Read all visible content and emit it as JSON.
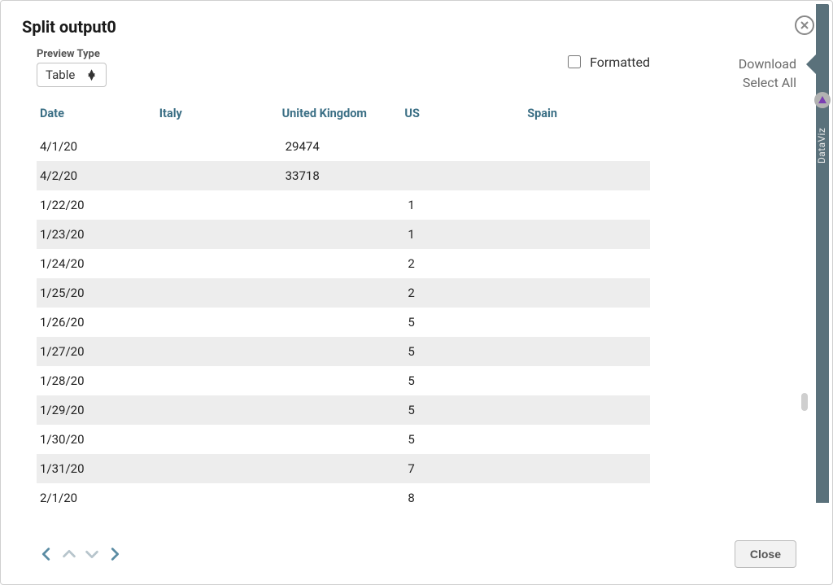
{
  "title": "Split output0",
  "previewType": {
    "label": "Preview Type",
    "value": "Table"
  },
  "formatted": {
    "label": "Formatted",
    "checked": false
  },
  "links": {
    "download": "Download",
    "selectAll": "Select All"
  },
  "sidePanel": {
    "label": "DataViz"
  },
  "columns": [
    "Date",
    "Italy",
    "United Kingdom",
    "US",
    "Spain"
  ],
  "rows": [
    {
      "date": "4/1/20",
      "italy": "",
      "uk": "29474",
      "us": "",
      "spain": ""
    },
    {
      "date": "4/2/20",
      "italy": "",
      "uk": "33718",
      "us": "",
      "spain": ""
    },
    {
      "date": "1/22/20",
      "italy": "",
      "uk": "",
      "us": "1",
      "spain": ""
    },
    {
      "date": "1/23/20",
      "italy": "",
      "uk": "",
      "us": "1",
      "spain": ""
    },
    {
      "date": "1/24/20",
      "italy": "",
      "uk": "",
      "us": "2",
      "spain": ""
    },
    {
      "date": "1/25/20",
      "italy": "",
      "uk": "",
      "us": "2",
      "spain": ""
    },
    {
      "date": "1/26/20",
      "italy": "",
      "uk": "",
      "us": "5",
      "spain": ""
    },
    {
      "date": "1/27/20",
      "italy": "",
      "uk": "",
      "us": "5",
      "spain": ""
    },
    {
      "date": "1/28/20",
      "italy": "",
      "uk": "",
      "us": "5",
      "spain": ""
    },
    {
      "date": "1/29/20",
      "italy": "",
      "uk": "",
      "us": "5",
      "spain": ""
    },
    {
      "date": "1/30/20",
      "italy": "",
      "uk": "",
      "us": "5",
      "spain": ""
    },
    {
      "date": "1/31/20",
      "italy": "",
      "uk": "",
      "us": "7",
      "spain": ""
    },
    {
      "date": "2/1/20",
      "italy": "",
      "uk": "",
      "us": "8",
      "spain": ""
    }
  ],
  "footer": {
    "closeLabel": "Close"
  }
}
